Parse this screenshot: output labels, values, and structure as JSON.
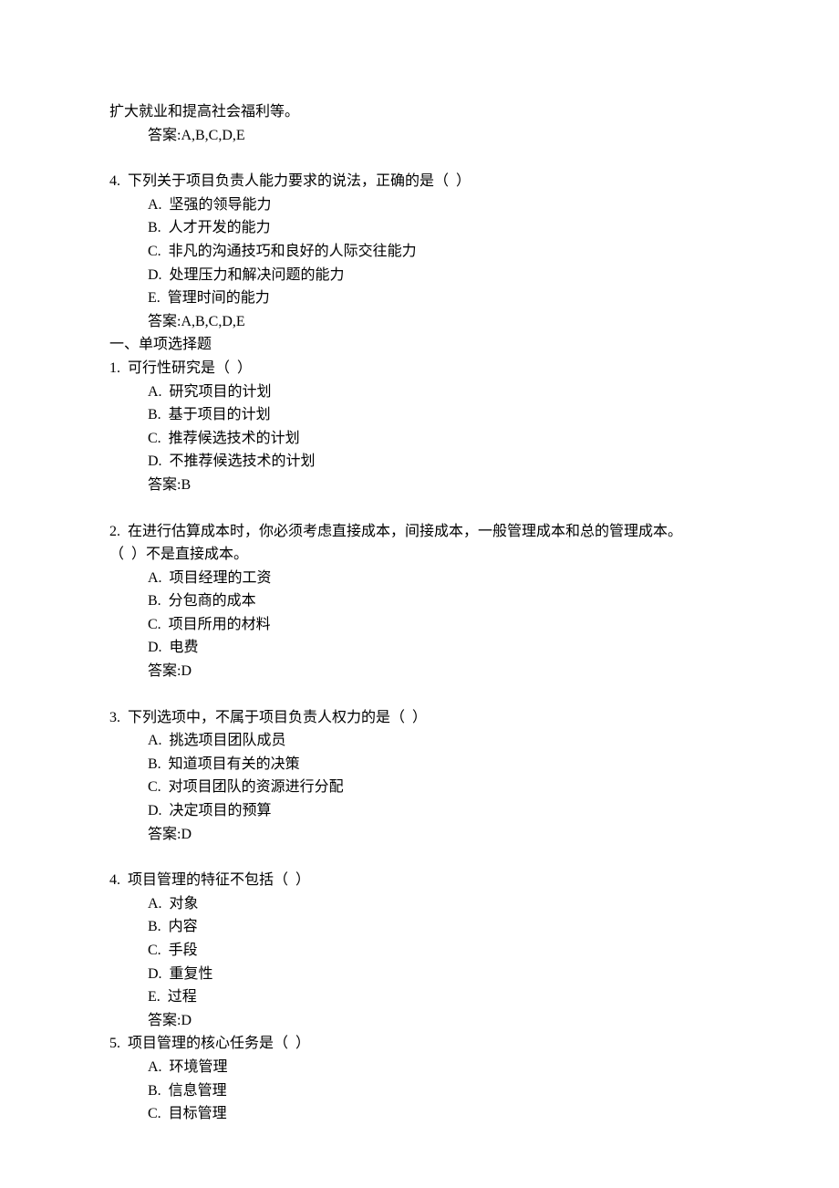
{
  "top": {
    "continuation": "扩大就业和提高社会福利等。",
    "answer": "答案:A,B,C,D,E"
  },
  "multi_q4": {
    "question": "4.  下列关于项目负责人能力要求的说法，正确的是（  ）",
    "options": {
      "a": "A.  坚强的领导能力",
      "b": "B.  人才开发的能力",
      "c": "C.  非凡的沟通技巧和良好的人际交往能力",
      "d": "D.  处理压力和解决问题的能力",
      "e": "E.  管理时间的能力"
    },
    "answer": "答案:A,B,C,D,E"
  },
  "section_heading": "一、单项选择题",
  "single_q1": {
    "question": "1.  可行性研究是（  ）",
    "options": {
      "a": "A.  研究项目的计划",
      "b": "B.  基于项目的计划",
      "c": "C.  推荐候选技术的计划",
      "d": "D.  不推荐候选技术的计划"
    },
    "answer": "答案:B"
  },
  "single_q2": {
    "question_line1": "2.  在进行估算成本时，你必须考虑直接成本，间接成本，一般管理成本和总的管理成本。",
    "question_line2": "（  ）不是直接成本。",
    "options": {
      "a": "A.  项目经理的工资",
      "b": "B.  分包商的成本",
      "c": "C.  项目所用的材料",
      "d": "D.  电费"
    },
    "answer": "答案:D"
  },
  "single_q3": {
    "question": "3.  下列选项中，不属于项目负责人权力的是（  ）",
    "options": {
      "a": "A.  挑选项目团队成员",
      "b": "B.  知道项目有关的决策",
      "c": "C.  对项目团队的资源进行分配",
      "d": "D.  决定项目的预算"
    },
    "answer": "答案:D"
  },
  "single_q4": {
    "question": "4.  项目管理的特征不包括（  ）",
    "options": {
      "a": "A.  对象",
      "b": "B.  内容",
      "c": "C.  手段",
      "d": "D.  重复性",
      "e": "E.  过程"
    },
    "answer": "答案:D"
  },
  "single_q5": {
    "question": "5.  项目管理的核心任务是（  ）",
    "options": {
      "a": "A.  环境管理",
      "b": "B.  信息管理",
      "c": "C.  目标管理"
    }
  }
}
